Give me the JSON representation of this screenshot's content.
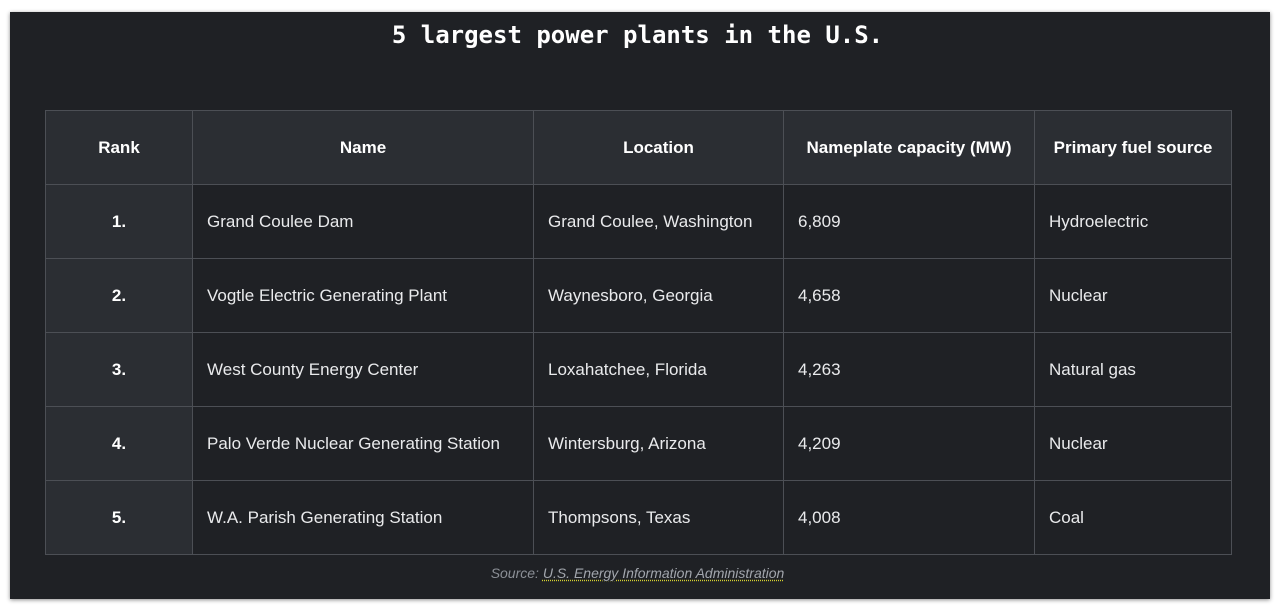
{
  "title": "5 largest power plants in the U.S.",
  "table": {
    "headers": [
      "Rank",
      "Name",
      "Location",
      "Nameplate capacity (MW)",
      "Primary fuel source"
    ],
    "rows": [
      {
        "rank": "1.",
        "name": "Grand Coulee Dam",
        "location": "Grand Coulee, Washington",
        "capacity": "6,809",
        "fuel": "Hydroelectric"
      },
      {
        "rank": "2.",
        "name": "Vogtle Electric Generating Plant",
        "location": "Waynesboro, Georgia",
        "capacity": "4,658",
        "fuel": "Nuclear"
      },
      {
        "rank": "3.",
        "name": "West County Energy Center",
        "location": "Loxahatchee, Florida",
        "capacity": "4,263",
        "fuel": "Natural gas"
      },
      {
        "rank": "4.",
        "name": "Palo Verde Nuclear Generating Station",
        "location": "Wintersburg, Arizona",
        "capacity": "4,209",
        "fuel": "Nuclear"
      },
      {
        "rank": "5.",
        "name": "W.A. Parish Generating Station",
        "location": "Thompsons, Texas",
        "capacity": "4,008",
        "fuel": "Coal"
      }
    ]
  },
  "source": {
    "prefix": "Source:",
    "link_text": "U.S. Energy Information Administration"
  }
}
